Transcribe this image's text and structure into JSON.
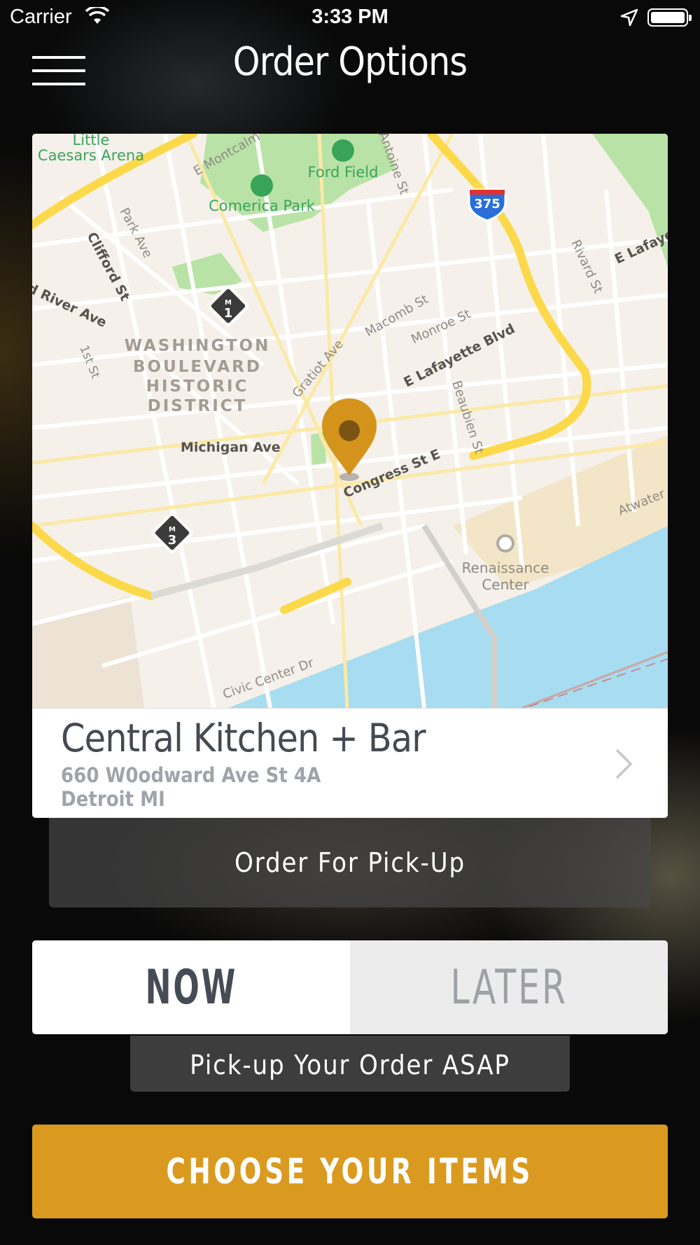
{
  "status_bar": {
    "carrier": "Carrier",
    "time": "3:33 PM"
  },
  "header": {
    "title": "Order Options"
  },
  "map": {
    "labels": {
      "little": "Little",
      "caesars_arena": "Caesars Arena",
      "ford_field": "Ford Field",
      "comerica_park": "Comerica Park",
      "e_montcalm": "E Montcalm",
      "antoine_st": "Antoine St",
      "park_ave": "Park Ave",
      "clifford_st": "Clifford St",
      "river_ave": "d River Ave",
      "first_st": "1st St",
      "washington": "WASHINGTON",
      "boulevard": "BOULEVARD",
      "historic": "HISTORIC",
      "district": "DISTRICT",
      "gratiot_ave": "Gratiot Ave",
      "macomb_st": "Macomb St",
      "monroe_st": "Monroe St",
      "e_lafayette_blvd": "E Lafayette Blvd",
      "beaubien_st": "Beaubien St",
      "rivard_st": "Rivard St",
      "e_lafaye": "E Lafaye",
      "michigan_ave": "Michigan Ave",
      "congress_st_e": "Congress St E",
      "renaissance": "Renaissance",
      "center": "Center",
      "atwater": "Atwater",
      "civic_center_dr": "Civic Center Dr",
      "i375": "375",
      "m1": "1",
      "m3": "3",
      "m_letter": "M"
    },
    "colors": {
      "land": "#f5f1ea",
      "water": "#a8dcf0",
      "park": "#b9e3a6",
      "highway": "#fcd94b",
      "pin": "#d4941c"
    }
  },
  "location": {
    "name": "Central Kitchen + Bar",
    "address": "660 W0odward Ave St 4A",
    "city": "Detroit MI"
  },
  "order_type": {
    "label": "Order For Pick-Up"
  },
  "timing": {
    "now_label": "NOW",
    "later_label": "LATER",
    "selected": "NOW",
    "note": "Pick-up Your Order ASAP"
  },
  "cta": {
    "label": "CHOOSE YOUR ITEMS",
    "color": "#d99a1f"
  }
}
